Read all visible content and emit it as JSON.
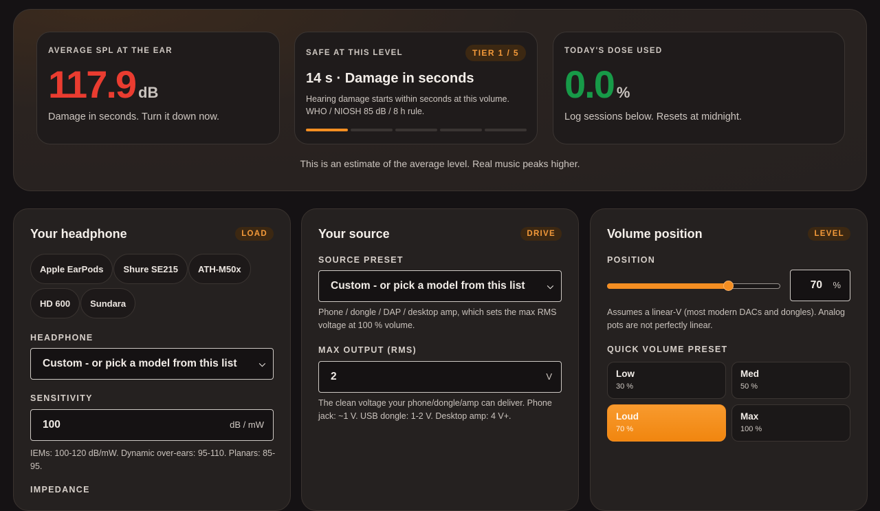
{
  "hero": {
    "spl": {
      "label": "AVERAGE SPL AT THE EAR",
      "value": "117.9",
      "unit": "dB",
      "subtitle": "Damage in seconds. Turn it down now.",
      "color": "#ea3c30"
    },
    "safe": {
      "label": "SAFE AT THIS LEVEL",
      "tier_badge": "TIER 1 / 5",
      "title": "14 s · Damage in seconds",
      "description_line1": "Hearing damage starts within seconds at this volume.",
      "description_line2": "WHO / NIOSH 85 dB / 8 h rule.",
      "tier_level": 1,
      "tier_count": 5
    },
    "dose": {
      "label": "TODAY'S DOSE USED",
      "value": "0.0",
      "unit": "%",
      "subtitle": "Log sessions below. Resets at midnight.",
      "color": "#179a48"
    },
    "note": "This is an estimate of the average level. Real music peaks higher."
  },
  "headphone": {
    "title": "Your headphone",
    "badge": "LOAD",
    "chips": [
      "Apple EarPods",
      "Shure SE215",
      "ATH-M50x",
      "HD 600",
      "Sundara"
    ],
    "headphone_label": "HEADPHONE",
    "headphone_select": "Custom - or pick a model from this list",
    "sensitivity_label": "SENSITIVITY",
    "sensitivity_value": "100",
    "sensitivity_unit": "dB / mW",
    "sensitivity_hint": "IEMs: 100-120 dB/mW. Dynamic over-ears: 95-110. Planars: 85-95.",
    "impedance_label": "IMPEDANCE"
  },
  "source": {
    "title": "Your source",
    "badge": "DRIVE",
    "preset_label": "SOURCE PRESET",
    "preset_select": "Custom - or pick a model from this list",
    "preset_hint": "Phone / dongle / DAP / desktop amp, which sets the max RMS voltage at 100 % volume.",
    "max_output_label": "MAX OUTPUT (RMS)",
    "max_output_value": "2",
    "max_output_unit": "V",
    "max_output_hint": "The clean voltage your phone/dongle/amp can deliver. Phone jack: ~1 V. USB dongle: 1-2 V. Desktop amp: 4 V+."
  },
  "volume": {
    "title": "Volume position",
    "badge": "LEVEL",
    "position_label": "POSITION",
    "position_value": "70",
    "position_percent": 70,
    "position_unit": "%",
    "position_hint": "Assumes a linear-V (most modern DACs and dongles). Analog pots are not perfectly linear.",
    "quick_label": "QUICK VOLUME PRESET",
    "presets": [
      {
        "name": "Low",
        "value": "30 %"
      },
      {
        "name": "Med",
        "value": "50 %"
      },
      {
        "name": "Loud",
        "value": "70 %",
        "active": true
      },
      {
        "name": "Max",
        "value": "100 %"
      }
    ]
  },
  "colors": {
    "accent": "#f48e22",
    "danger": "#ea3c30",
    "safe": "#179a48"
  }
}
